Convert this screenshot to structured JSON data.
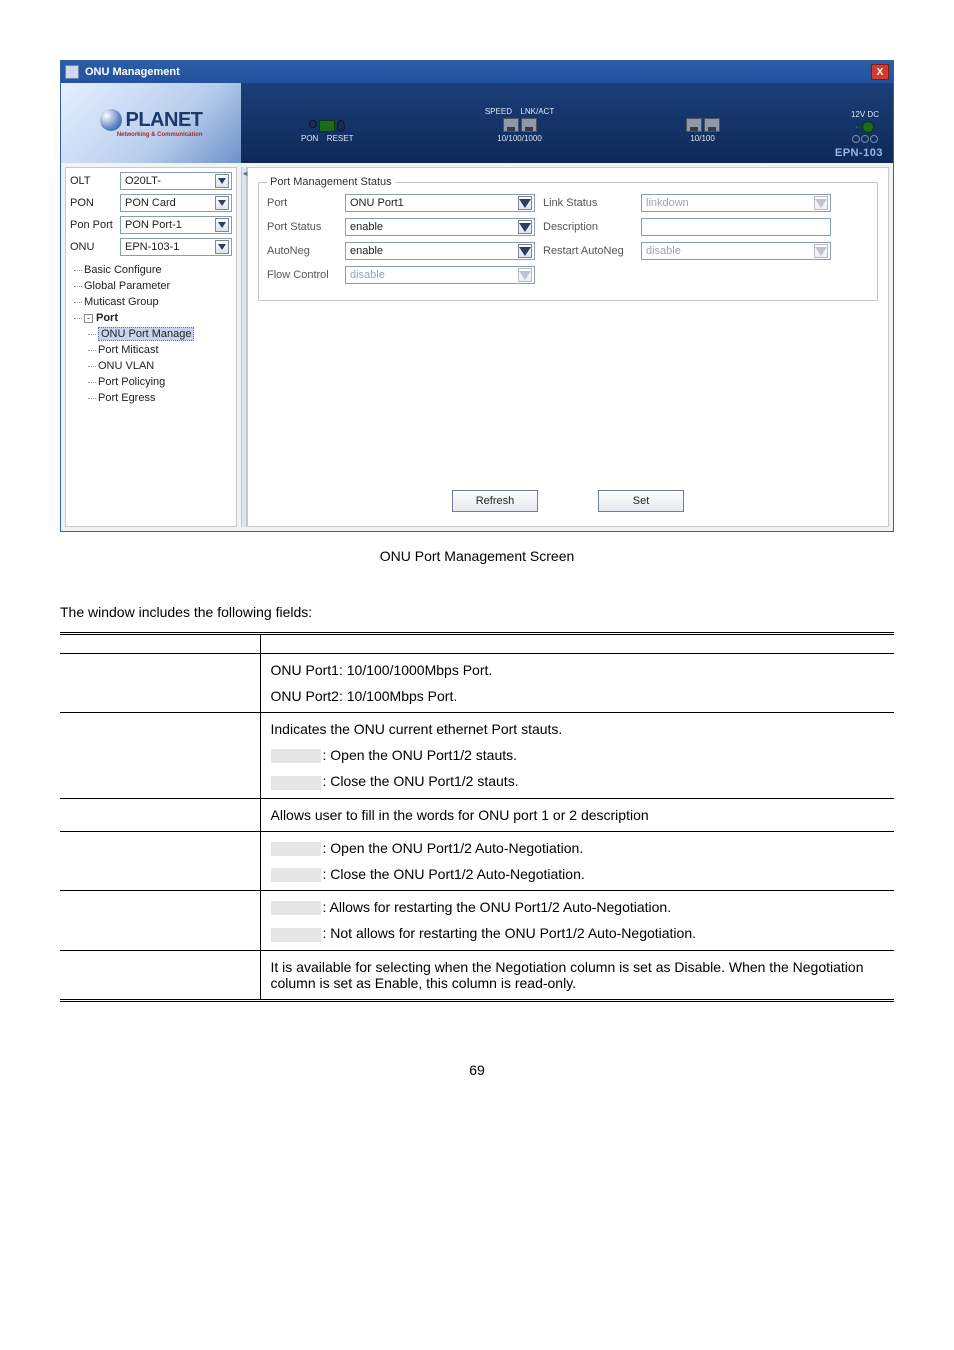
{
  "window": {
    "title": "ONU Management",
    "close_glyph": "X"
  },
  "banner": {
    "brand": "PLANET",
    "brand_sub": "Networking & Communication",
    "labels": {
      "speed": "SPEED",
      "lnkact": "LNK/ACT",
      "pon": "PON",
      "reset": "RESET",
      "p1": "10/100/1000",
      "p2": "10/100",
      "dc": "12V DC"
    },
    "model": "EPN-103"
  },
  "sidebar": {
    "selectors": {
      "olt": {
        "label": "OLT",
        "value": "O20LT-"
      },
      "pon": {
        "label": "PON",
        "value": "PON Card"
      },
      "ponport": {
        "label": "Pon Port",
        "value": "PON Port-1"
      },
      "onu": {
        "label": "ONU",
        "value": "EPN-103-1"
      }
    },
    "tree": {
      "basic": "Basic Configure",
      "global": "Global Parameter",
      "muticast": "Muticast Group",
      "port": "Port",
      "port_children": {
        "manage": "ONU Port Manage",
        "miticast": "Port Miticast",
        "vlan": "ONU VLAN",
        "policy": "Port Policying",
        "egress": "Port Egress"
      }
    }
  },
  "form": {
    "legend": "Port Management Status",
    "rows": {
      "port": {
        "label": "Port",
        "value": "ONU Port1"
      },
      "linkstatus": {
        "label": "Link Status",
        "value": "linkdown"
      },
      "portstatus": {
        "label": "Port Status",
        "value": "enable"
      },
      "description": {
        "label": "Description",
        "value": ""
      },
      "autoneg": {
        "label": "AutoNeg",
        "value": "enable"
      },
      "restart": {
        "label": "Restart AutoNeg",
        "value": "disable"
      },
      "flowcontrol": {
        "label": "Flow Control",
        "value": "disable"
      }
    },
    "buttons": {
      "refresh": "Refresh",
      "set": "Set"
    }
  },
  "caption": "ONU Port Management Screen",
  "intro": "The window includes the following fields:",
  "table": {
    "rows": [
      {
        "desc_lines": [
          {
            "text": "ONU Port1: 10/100/1000Mbps Port."
          },
          {
            "text": "ONU Port2: 10/100Mbps Port."
          }
        ]
      },
      {
        "desc_lines": [
          {
            "text": "Indicates the ONU current ethernet Port stauts."
          },
          {
            "box": true,
            "text": ": Open the ONU Port1/2 stauts."
          },
          {
            "box": true,
            "text": ": Close the ONU Port1/2 stauts."
          }
        ]
      },
      {
        "desc_lines": [
          {
            "text": "Allows user to fill in the words for ONU port 1 or 2 description"
          }
        ]
      },
      {
        "desc_lines": [
          {
            "box": true,
            "text": ": Open the ONU Port1/2 Auto-Negotiation."
          },
          {
            "box": true,
            "text": ": Close the ONU Port1/2 Auto-Negotiation."
          }
        ]
      },
      {
        "desc_lines": [
          {
            "box": true,
            "text": ": Allows for restarting the ONU Port1/2 Auto-Negotiation."
          },
          {
            "box": true,
            "text": ": Not allows for restarting the ONU Port1/2 Auto-Negotiation."
          }
        ]
      },
      {
        "desc_lines": [
          {
            "text": "It is available for selecting when the Negotiation column is set as Disable. When the Negotiation column is set as Enable, this column is read-only."
          }
        ]
      }
    ]
  },
  "page_number": "69"
}
